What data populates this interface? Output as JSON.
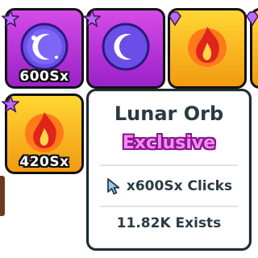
{
  "tiles": [
    {
      "label": "600Sx",
      "variant": "purple",
      "art": "moon-icon"
    },
    {
      "label": "",
      "variant": "purple",
      "art": "moon-icon"
    },
    {
      "label": "",
      "variant": "gold",
      "art": "fire-icon"
    },
    {
      "label": "",
      "variant": "gold",
      "art": "fire-icon"
    },
    {
      "label": "420Sx",
      "variant": "gold",
      "art": "fire-icon"
    }
  ],
  "tooltip": {
    "title": "Lunar Orb",
    "rarity": "Exclusive",
    "stat_text": "x600Sx Clicks",
    "stat_icon": "cursor-icon",
    "exists_text": "11.82K Exists"
  },
  "colors": {
    "rarity_fill": "#f38cf3",
    "rarity_outline": "#8a168f",
    "tile_purple": "#c13bdf",
    "tile_gold": "#ffc21f",
    "tooltip_border": "#1f2b33"
  }
}
